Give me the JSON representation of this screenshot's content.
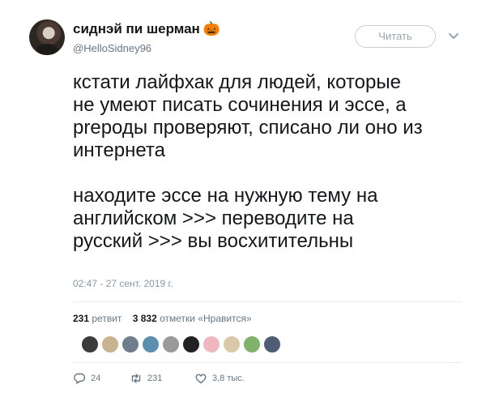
{
  "profile": {
    "display_name": "сиднэй пи шерман",
    "name_emoji": "🎃",
    "handle": "@HelloSidney96"
  },
  "follow_button": {
    "label": "Читать"
  },
  "tweet": {
    "text": "кстати лайфхак для людей, которые\nне умеют писать сочинения и эссе, а\npreроды проверяют, списано ли оно из\nинтернета\n\nнаходите эссе на нужную тему на\nанглийском >>> переводите на\nрусский >>> вы восхитительны",
    "timestamp": "02:47 - 27 сент. 2019 г."
  },
  "stats": {
    "retweets_count": "231",
    "retweets_label": "ретвит",
    "likes_count": "3 832",
    "likes_label": "отметки «Нравится»"
  },
  "likers": [
    {
      "name": "liker-avatar-1",
      "color": "#3b3b3b"
    },
    {
      "name": "liker-avatar-2",
      "color": "#c9b28f"
    },
    {
      "name": "liker-avatar-3",
      "color": "#6f7d8c"
    },
    {
      "name": "liker-avatar-4",
      "color": "#5a8fb0"
    },
    {
      "name": "liker-avatar-5",
      "color": "#9a9a9a"
    },
    {
      "name": "liker-avatar-6",
      "color": "#222222"
    },
    {
      "name": "liker-avatar-7",
      "color": "#f1b7c0"
    },
    {
      "name": "liker-avatar-8",
      "color": "#d9c9a8"
    },
    {
      "name": "liker-avatar-9",
      "color": "#7fb36a"
    },
    {
      "name": "liker-avatar-10",
      "color": "#4f5d74"
    }
  ],
  "actions": {
    "replies": "24",
    "retweets": "231",
    "likes": "3,8 тыс."
  },
  "icons": {
    "reply": "reply-icon",
    "retweet": "retweet-icon",
    "like": "heart-icon",
    "caret": "chevron-down-icon"
  }
}
